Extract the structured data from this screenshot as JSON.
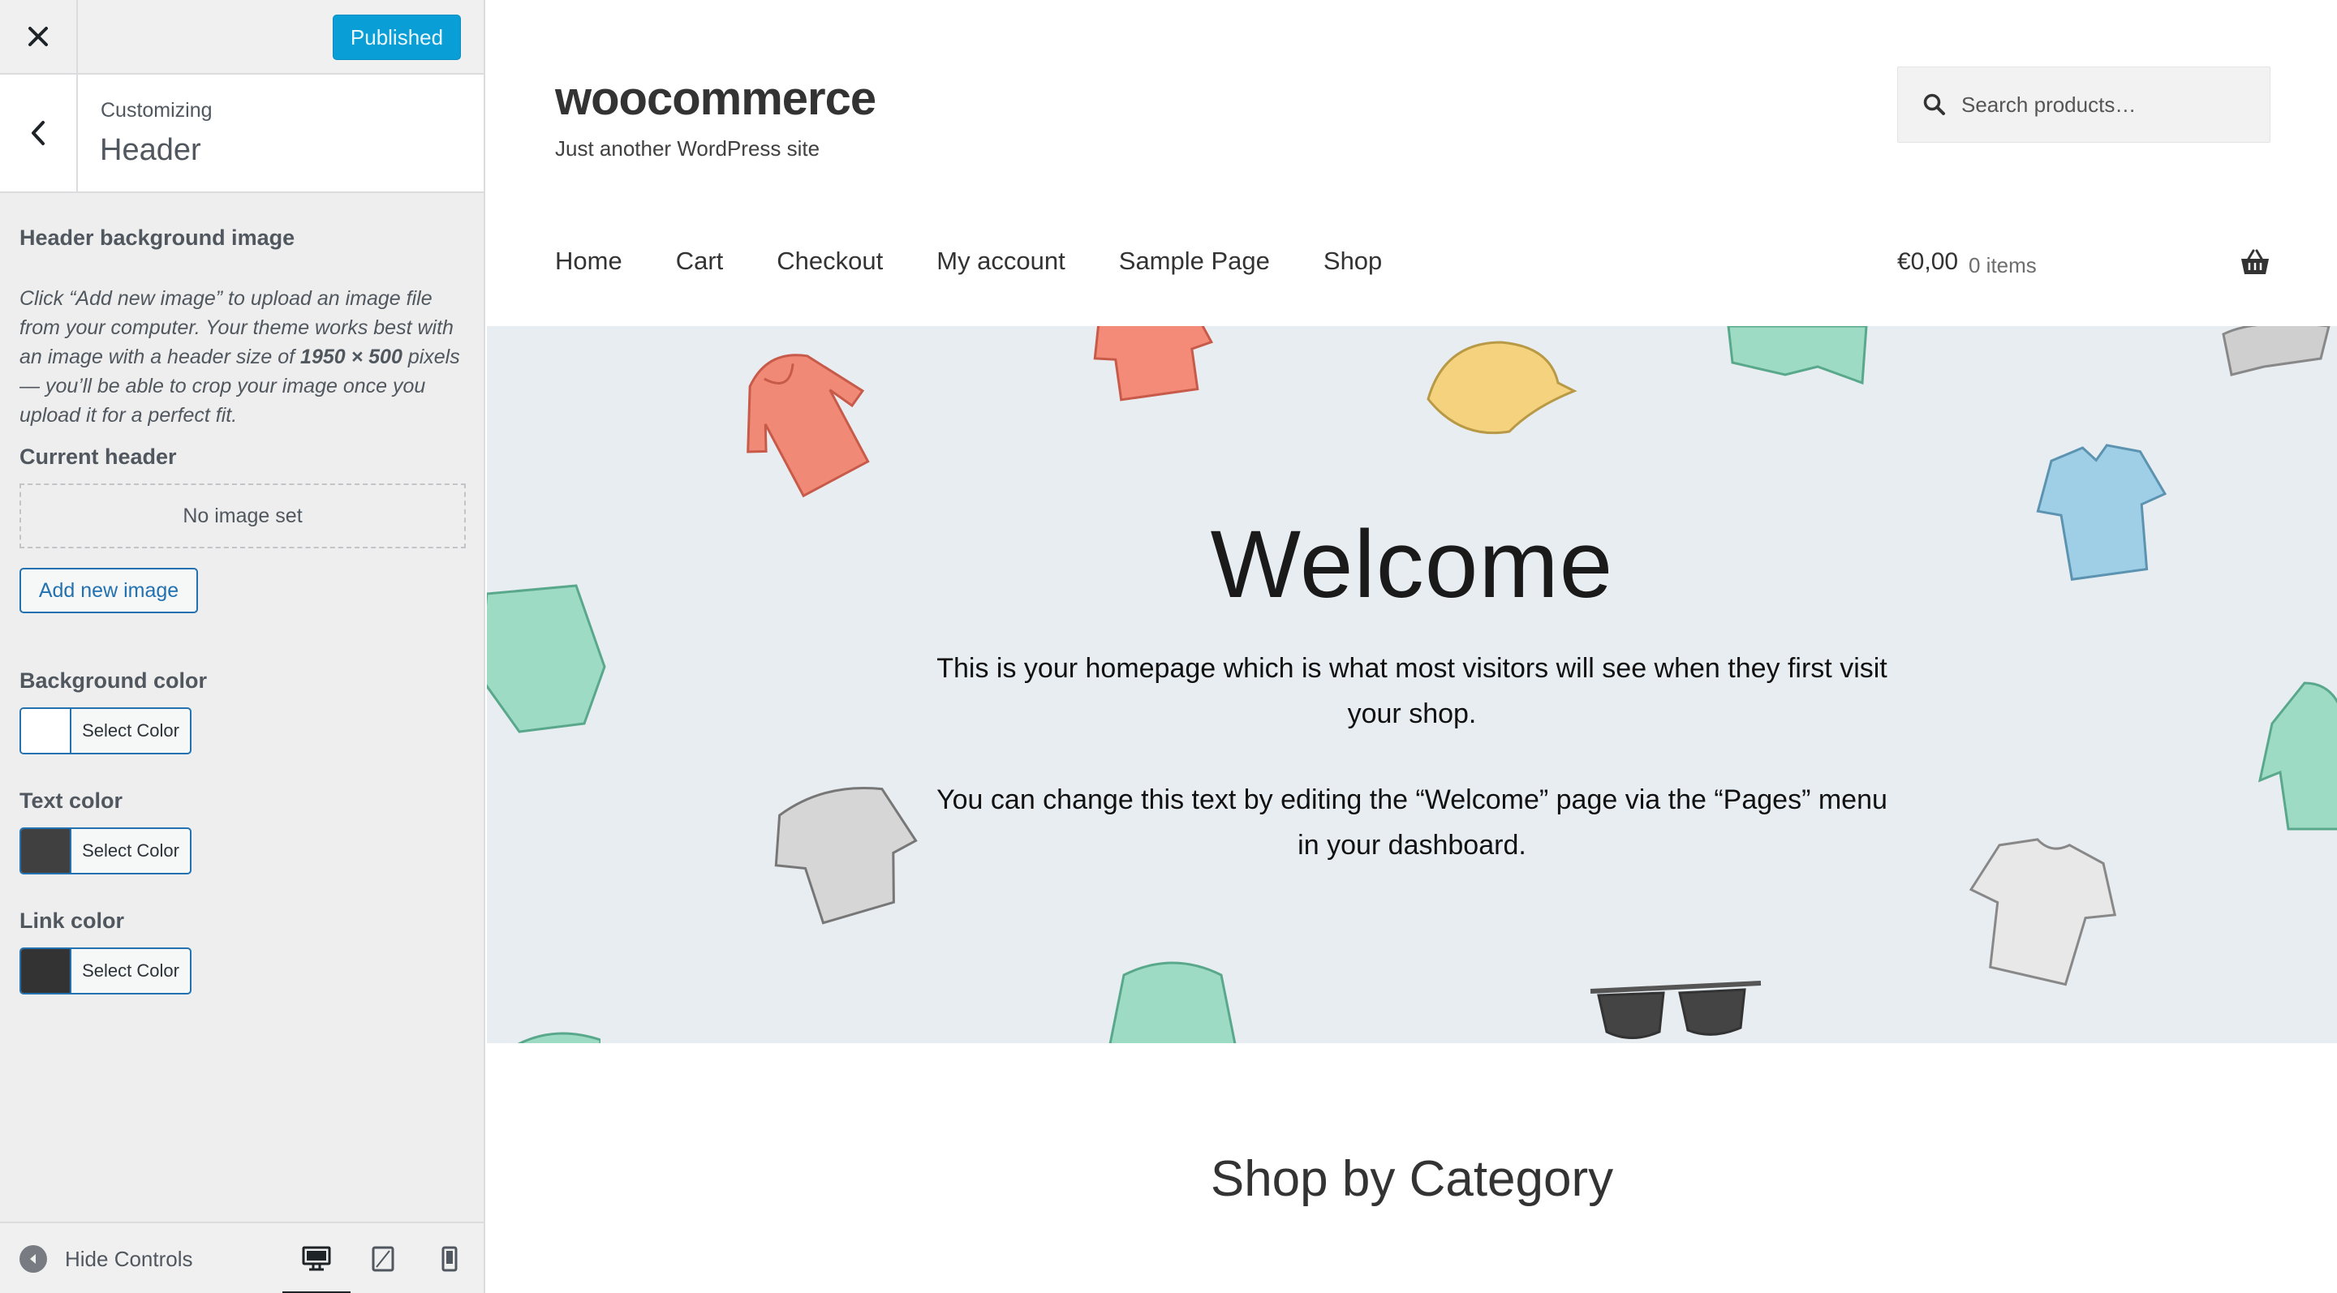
{
  "customizer": {
    "publish_label": "Published",
    "breadcrumb": "Customizing",
    "section_title": "Header",
    "header_image": {
      "heading": "Header background image",
      "description_pre": "Click “Add new image” to upload an image file from your computer. Your theme works best with an image with a header size of ",
      "description_size": "1950 × 500",
      "description_post": " pixels — you’ll be able to crop your image once you upload it for a perfect fit.",
      "current_heading": "Current header",
      "no_image": "No image set",
      "add_button": "Add new image"
    },
    "background_color": {
      "heading": "Background color",
      "select_label": "Select Color",
      "value": "#ffffff"
    },
    "text_color": {
      "heading": "Text color",
      "select_label": "Select Color",
      "value": "#404040"
    },
    "link_color": {
      "heading": "Link color",
      "select_label": "Select Color",
      "value": "#333333"
    },
    "footer": {
      "hide_controls": "Hide Controls",
      "devices": [
        "desktop-icon",
        "tablet-icon",
        "mobile-icon"
      ],
      "active_device": "desktop"
    }
  },
  "site": {
    "title": "woocommerce",
    "tagline": "Just another WordPress site",
    "search_placeholder": "Search products…",
    "nav": [
      "Home",
      "Cart",
      "Checkout",
      "My account",
      "Sample Page",
      "Shop"
    ],
    "cart_total": "€0,00",
    "cart_count": "0 items",
    "hero": {
      "title": "Welcome",
      "text_1": "This is your homepage which is what most visitors will see when they first visit your shop.",
      "text_2": "You can change this text by editing the “Welcome” page via the “Pages” menu in your dashboard."
    },
    "section_heading": "Shop by Category"
  },
  "colors": {
    "accent": "#2271b1",
    "publish": "#0a9ed6",
    "hero_bg": "#e8edf1"
  }
}
